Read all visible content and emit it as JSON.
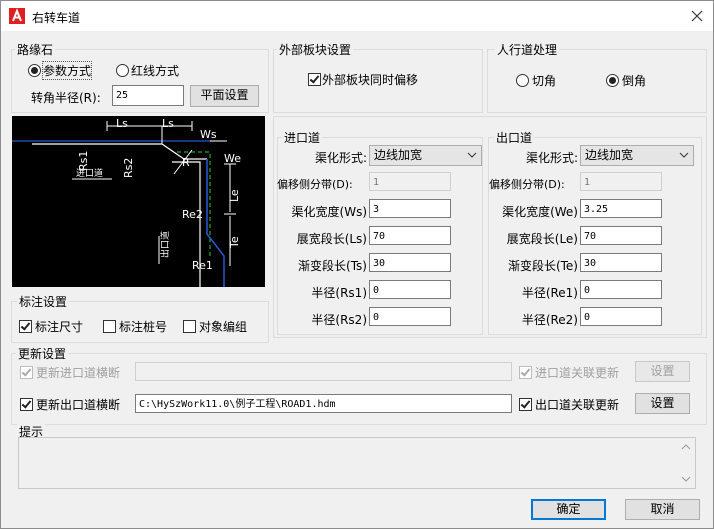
{
  "window": {
    "title": "右转车道"
  },
  "curb": {
    "title": "路缘石",
    "mode_param": "参数方式",
    "mode_redline": "红线方式",
    "radius_label": "转角半径(R):",
    "radius_value": "25",
    "plane_btn": "平面设置"
  },
  "outer": {
    "title": "外部板块设置",
    "sync_label": "外部板块同时偏移"
  },
  "sidewalk": {
    "title": "人行道处理",
    "cut": "切角",
    "chamfer": "倒角"
  },
  "diagram": {
    "labels": [
      "Ls",
      "Ls",
      "Ws",
      "R",
      "We",
      "Rs1",
      "Rs2",
      "进口道",
      "Le",
      "Re2",
      "Te",
      "出口道",
      "Re1"
    ]
  },
  "entry": {
    "title": "进口道",
    "form_label": "渠化形式:",
    "form_value": "边线加宽",
    "offset_label": "偏移侧分带(D):",
    "offset_value": "1",
    "width_label": "渠化宽度(Ws)",
    "width_value": "3",
    "len_label": "展宽段长(Ls)",
    "len_value": "70",
    "trans_label": "渐变段长(Ts)",
    "trans_value": "30",
    "r1_label": "半径(Rs1)",
    "r1_value": "0",
    "r2_label": "半径(Rs2)",
    "r2_value": "0"
  },
  "exit": {
    "title": "出口道",
    "form_label": "渠化形式:",
    "form_value": "边线加宽",
    "offset_label": "偏移侧分带(D):",
    "offset_value": "1",
    "width_label": "渠化宽度(We)",
    "width_value": "3.25",
    "len_label": "展宽段长(Le)",
    "len_value": "70",
    "trans_label": "渐变段长(Te)",
    "trans_value": "30",
    "r1_label": "半径(Re1)",
    "r1_value": "0",
    "r2_label": "半径(Re2)",
    "r2_value": "0"
  },
  "annot": {
    "title": "标注设置",
    "size": "标注尺寸",
    "station": "标注桩号",
    "obj": "对象编组"
  },
  "update": {
    "title": "更新设置",
    "entry_cs": "更新进口道横断",
    "entry_path": "",
    "entry_link": "进口道关联更新",
    "entry_btn": "设置",
    "exit_cs": "更新出口道横断",
    "exit_path": "C:\\HySzWork11.0\\例子工程\\ROAD1.hdm",
    "exit_link": "出口道关联更新",
    "exit_btn": "设置"
  },
  "hint": {
    "title": "提示",
    "text": ""
  },
  "buttons": {
    "ok": "确定",
    "cancel": "取消"
  }
}
